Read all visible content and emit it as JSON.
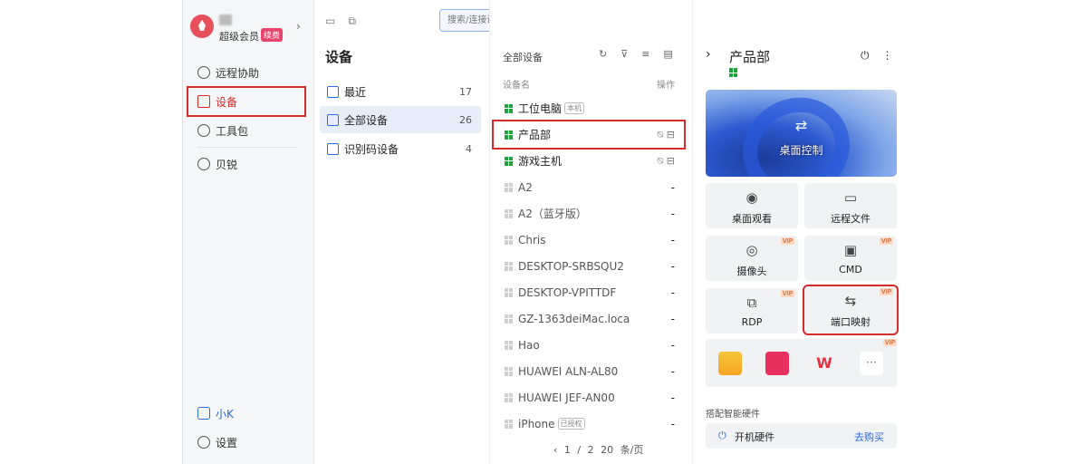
{
  "window": {
    "search_placeholder": "搜索/连接设备",
    "controls": [
      "bell-icon",
      "minimize-icon",
      "close-icon"
    ]
  },
  "profile": {
    "member": "超级会员",
    "renew": "续费"
  },
  "nav": [
    {
      "id": "remote",
      "label": "远程协助"
    },
    {
      "id": "devices",
      "label": "设备"
    },
    {
      "id": "tools",
      "label": "工具包"
    },
    {
      "id": "beirui",
      "label": "贝锐"
    }
  ],
  "nav_bottom": [
    {
      "label": "小K"
    },
    {
      "label": "设置"
    }
  ],
  "devices_panel": {
    "title": "设备",
    "items": [
      {
        "label": "最近",
        "count": "17"
      },
      {
        "label": "全部设备",
        "count": "26"
      },
      {
        "label": "识别码设备",
        "count": "4"
      }
    ]
  },
  "list": {
    "title": "全部设备",
    "col_name": "设备名",
    "col_ops": "操作",
    "rows": [
      {
        "name": "工位电脑",
        "tag": "本机",
        "online": true,
        "ops": ""
      },
      {
        "name": "产品部",
        "tag": "",
        "online": true,
        "ops": "⍉ ⊟"
      },
      {
        "name": "游戏主机",
        "tag": "",
        "online": true,
        "ops": "⍉ ⊟"
      },
      {
        "name": "A2",
        "tag": "",
        "online": false,
        "ops": "-"
      },
      {
        "name": "A2（蓝牙版）",
        "tag": "",
        "online": false,
        "ops": "-"
      },
      {
        "name": "Chris",
        "tag": "",
        "online": false,
        "ops": "-"
      },
      {
        "name": "DESKTOP-SRBSQU2",
        "tag": "",
        "online": false,
        "ops": "-"
      },
      {
        "name": "DESKTOP-VPITTDF",
        "tag": "",
        "online": false,
        "ops": "-"
      },
      {
        "name": "GZ-1363deiMac.loca",
        "tag": "",
        "online": false,
        "ops": "-"
      },
      {
        "name": "Hao",
        "tag": "",
        "online": false,
        "ops": "-"
      },
      {
        "name": "HUAWEI ALN-AL80",
        "tag": "",
        "online": false,
        "ops": "-"
      },
      {
        "name": "HUAWEI JEF-AN00",
        "tag": "",
        "online": false,
        "ops": "-"
      },
      {
        "name": "iPhone",
        "tag": "已授权",
        "online": false,
        "ops": "-"
      }
    ],
    "pager": {
      "page": "1",
      "sep": "/",
      "total": "2",
      "size": "20 条/页"
    }
  },
  "detail": {
    "title": "产品部",
    "hero_label": "桌面控制",
    "tiles": [
      {
        "label": "桌面观看",
        "icon": "eye-icon",
        "vip": ""
      },
      {
        "label": "远程文件",
        "icon": "folder-icon",
        "vip": ""
      },
      {
        "label": "摄像头",
        "icon": "camera-icon",
        "vip": "VIP"
      },
      {
        "label": "CMD",
        "icon": "cmd-icon",
        "vip": "VIP"
      },
      {
        "label": "RDP",
        "icon": "rdp-icon",
        "vip": "VIP"
      },
      {
        "label": "端口映射",
        "icon": "port-mapping-icon",
        "vip": "VIP"
      }
    ],
    "apps_vip": "VIP",
    "more": "···",
    "hw_label": "搭配智能硬件",
    "hw_text": "开机硬件",
    "hw_buy": "去购买"
  },
  "colors": {
    "accent": "#2e6bd9",
    "highlight": "#d42b2b",
    "online": "#1fa33b"
  }
}
